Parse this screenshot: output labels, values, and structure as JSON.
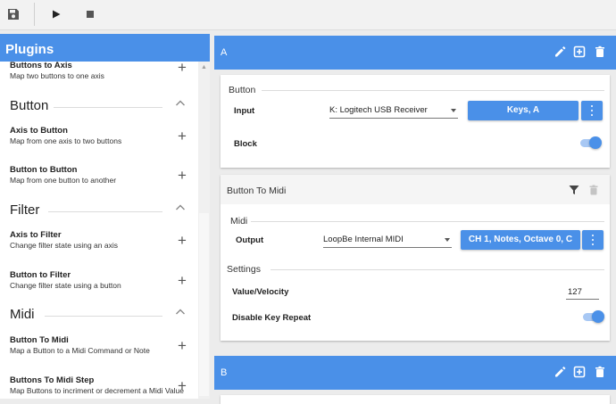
{
  "toolbar": {
    "save_icon": "save-icon",
    "play_icon": "play-icon",
    "stop_icon": "stop-icon"
  },
  "plugins": {
    "title": "Plugins",
    "sections": [
      {
        "name": "",
        "items": [
          {
            "title": "Buttons to Axis",
            "desc": "Map two buttons to one axis"
          }
        ]
      },
      {
        "name": "Button",
        "items": [
          {
            "title": "Axis to Button",
            "desc": "Map from one axis to two buttons"
          },
          {
            "title": "Button to Button",
            "desc": "Map from one button to another"
          }
        ]
      },
      {
        "name": "Filter",
        "items": [
          {
            "title": "Axis to Filter",
            "desc": "Change filter state using an axis"
          },
          {
            "title": "Button to Filter",
            "desc": "Change filter state using a button"
          }
        ]
      },
      {
        "name": "Midi",
        "items": [
          {
            "title": "Button To Midi",
            "desc": "Map a Button to a Midi Command or Note"
          },
          {
            "title": "Buttons To Midi Step",
            "desc": "Map Buttons to incriment or decrement a Midi Value"
          }
        ]
      }
    ]
  },
  "blocks": [
    {
      "name": "A",
      "button": {
        "title": "Button",
        "input_label": "Input",
        "input_value": "K: Logitech USB Receiver",
        "key_button": "Keys, A",
        "block_label": "Block",
        "block_on": true
      },
      "plugin": {
        "title": "Button To Midi",
        "midi_title": "Midi",
        "output_label": "Output",
        "output_value": "LoopBe Internal MIDI",
        "command_button": "CH 1, Notes, Octave 0, C",
        "settings_title": "Settings",
        "velocity_label": "Value/Velocity",
        "velocity_value": "127",
        "repeat_label": "Disable Key Repeat",
        "repeat_on": true
      }
    },
    {
      "name": "B"
    }
  ],
  "colors": {
    "accent": "#4a90e8",
    "toggle_track": "#a8c8f4"
  }
}
